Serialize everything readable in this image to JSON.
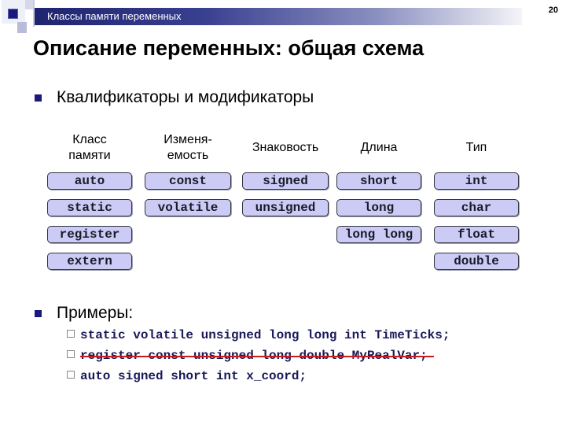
{
  "header": {
    "section_title": "Классы памяти переменных",
    "page_number": "20"
  },
  "slide": {
    "title": "Описание переменных: общая схема",
    "bullet1": "Квалификаторы и модификаторы",
    "bullet2": "Примеры:"
  },
  "columns": [
    {
      "header": [
        "Класс",
        "памяти"
      ],
      "items": [
        "auto",
        "static",
        "register",
        "extern"
      ]
    },
    {
      "header": [
        "Изменя-",
        "емость"
      ],
      "items": [
        "const",
        "volatile"
      ]
    },
    {
      "header": [
        "Знаковость"
      ],
      "items": [
        "signed",
        "unsigned"
      ]
    },
    {
      "header": [
        "Длина"
      ],
      "items": [
        "short",
        "long",
        "long long"
      ]
    },
    {
      "header": [
        "Тип"
      ],
      "items": [
        "int",
        "char",
        "float",
        "double"
      ]
    }
  ],
  "examples": [
    {
      "code": "static volatile unsigned long long int TimeTicks;",
      "struck": false
    },
    {
      "code": "register const unsigned long double MyRealVar;",
      "struck": true
    },
    {
      "code": "auto signed short int x_coord;",
      "struck": false
    }
  ],
  "colors": {
    "accent": "#1a1a7a",
    "pill_fill": "#cbcbf5",
    "strike": "#cc1a1a"
  }
}
